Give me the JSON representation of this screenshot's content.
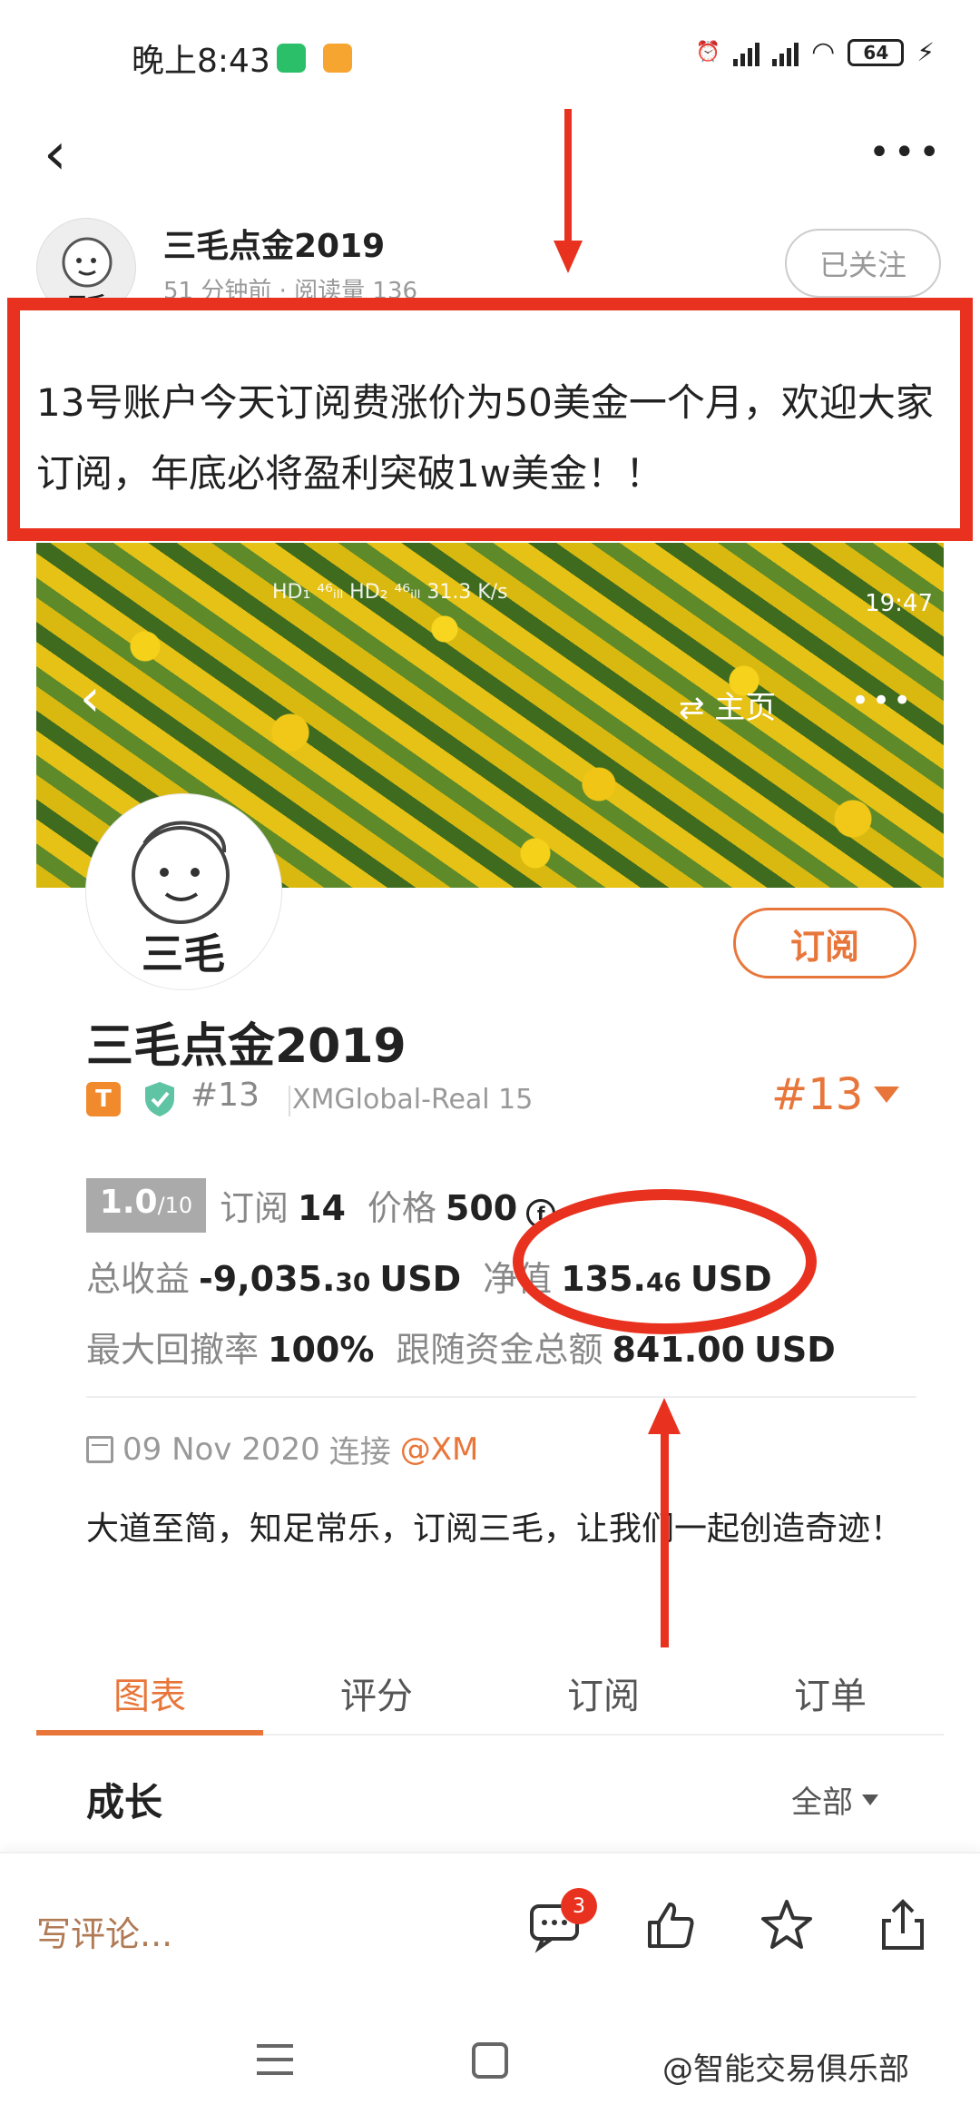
{
  "status_bar": {
    "time": "晚上8:43",
    "battery": "64"
  },
  "post": {
    "author": "三毛点金2019",
    "meta": "51 分钟前 · 阅读量 136",
    "follow_label": "已关注",
    "highlight_text": "13号账户今天订阅费涨价为50美金一个月，欢迎大家订阅，年底必将盈利突破1w美金！！"
  },
  "banner": {
    "status_time": "19:47",
    "status_misc": "HD₁ ⁴⁶ᵢₗₗ HD₂ ⁴⁶ᵢₗₗ  31.3 K/s",
    "home_label": "⇄ 主页",
    "more_label": "•••"
  },
  "profile": {
    "name": "三毛点金2019",
    "subscribe_label": "订阅",
    "badge_t": "T",
    "rank_small": "#13",
    "account": "XMGlobal-Real 15",
    "rank_big": "#13",
    "score": "1.0",
    "score_max": "/10",
    "subscribe_count_label": "订阅",
    "subscribe_count": "14",
    "price_label": "价格",
    "price": "500",
    "total_profit_label": "总收益",
    "total_profit_int": "-9,035.",
    "total_profit_dec": "30",
    "total_profit_unit": "USD",
    "net_value_label": "净值",
    "net_value_int": "135.",
    "net_value_dec": "46",
    "net_value_unit": "USD",
    "max_drawdown_label": "最大回撤率",
    "max_drawdown": "100%",
    "follow_funds_label": "跟随资金总额",
    "follow_funds": "841.00",
    "follow_funds_unit": "USD",
    "date": "09 Nov 2020",
    "connect_label": "连接",
    "broker": "@XM",
    "bio": "大道至简，知足常乐，订阅三毛，让我们一起创造奇迹！"
  },
  "tabs": [
    "图表",
    "评分",
    "订阅",
    "订单"
  ],
  "section": {
    "title": "成长",
    "filter": "全部"
  },
  "bottom_bar": {
    "comment_placeholder": "写评论...",
    "comment_count": "3"
  },
  "watermark": "@智能交易俱乐部",
  "colors": {
    "accent": "#e8763a",
    "annotation_red": "#e8321f"
  }
}
